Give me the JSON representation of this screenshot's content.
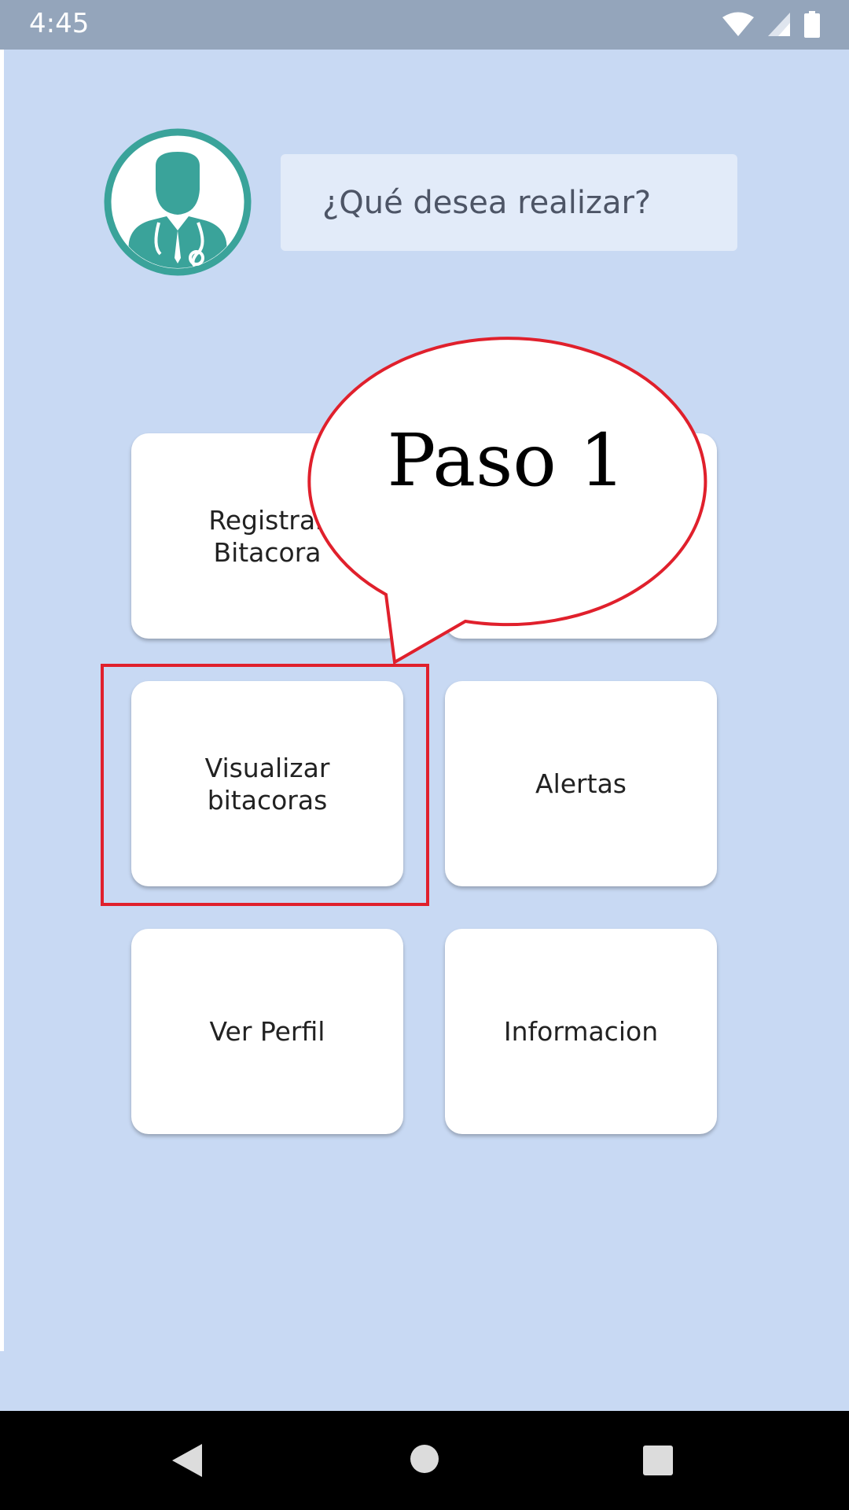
{
  "status_bar": {
    "time": "4:45"
  },
  "header": {
    "prompt": "¿Qué desea realizar?"
  },
  "menu": {
    "items": [
      {
        "label": "Registrar\nBitacora"
      },
      {
        "label": ""
      },
      {
        "label": "Visualizar\nbitacoras"
      },
      {
        "label": "Alertas"
      },
      {
        "label": "Ver Perfil"
      },
      {
        "label": "Informacion"
      }
    ]
  },
  "callout": {
    "text": "Paso 1"
  },
  "colors": {
    "background": "#c8d9f3",
    "avatar": "#3aa39a",
    "highlight": "#e0202c"
  },
  "icons": [
    "wifi-icon",
    "signal-icon",
    "battery-icon",
    "doctor-avatar-icon",
    "back-icon",
    "home-icon",
    "recents-icon"
  ]
}
